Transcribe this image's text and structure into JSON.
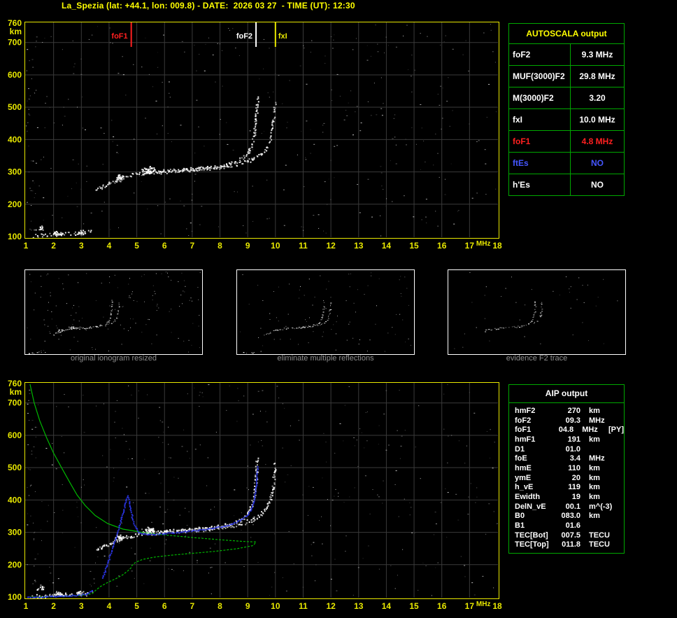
{
  "header": {
    "title": "La_Spezia (lat: +44.1, lon: 009.8) - DATE:  2026 03 27  - TIME (UT): 12:30"
  },
  "colors": {
    "background": "#000000",
    "axis_yellow": "#e8e800",
    "title_yellow": "#ffff00",
    "grid": "#3a3a3a",
    "trace_white": "#ffffff",
    "profile_green": "#00b800",
    "restored_blue": "#2a35e6",
    "fof1_red": "#ff2020",
    "ftes_blue": "#4556ff",
    "table_green": "#00a800",
    "caption_gray": "#8f8f8f"
  },
  "autoscala_table": {
    "title": "AUTOSCALA output",
    "rows": [
      {
        "label": "foF2",
        "value": "9.3 MHz",
        "color": "white"
      },
      {
        "label": "MUF(3000)F2",
        "value": "29.8 MHz",
        "color": "white"
      },
      {
        "label": "M(3000)F2",
        "value": "3.20",
        "color": "white"
      },
      {
        "label": "fxI",
        "value": "10.0 MHz",
        "color": "white"
      },
      {
        "label": "foF1",
        "value": "4.8 MHz",
        "color": "red"
      },
      {
        "label": "ftEs",
        "value": "NO",
        "color": "blue"
      },
      {
        "label": "h'Es",
        "value": "NO",
        "color": "white"
      }
    ]
  },
  "aip_table": {
    "title": "AIP output",
    "rows": [
      {
        "name": "hmF2",
        "value": "270",
        "unit": "km",
        "extra": ""
      },
      {
        "name": "foF2",
        "value": "09.3",
        "unit": "MHz",
        "extra": ""
      },
      {
        "name": "foF1",
        "value": "04.8",
        "unit": "MHz",
        "extra": "[PY]"
      },
      {
        "name": "hmF1",
        "value": "191",
        "unit": "km",
        "extra": ""
      },
      {
        "name": "D1",
        "value": "01.0",
        "unit": "",
        "extra": ""
      },
      {
        "name": "foE",
        "value": "3.4",
        "unit": "MHz",
        "extra": ""
      },
      {
        "name": "hmE",
        "value": "110",
        "unit": "km",
        "extra": ""
      },
      {
        "name": "ymE",
        "value": "20",
        "unit": "km",
        "extra": ""
      },
      {
        "name": "h_vE",
        "value": "119",
        "unit": "km",
        "extra": ""
      },
      {
        "name": "Ewidth",
        "value": "19",
        "unit": "km",
        "extra": ""
      },
      {
        "name": "DelN_vE",
        "value": "00.1",
        "unit": "m^(-3)",
        "extra": ""
      },
      {
        "name": "B0",
        "value": "083.0",
        "unit": "km",
        "extra": ""
      },
      {
        "name": "B1",
        "value": "01.6",
        "unit": "",
        "extra": ""
      },
      {
        "name": "TEC[Bot]",
        "value": "007.5",
        "unit": "TECU",
        "extra": ""
      },
      {
        "name": "TEC[Top]",
        "value": "011.8",
        "unit": "TECU",
        "extra": ""
      }
    ]
  },
  "thumbnails": [
    {
      "caption": "original ionogram resized",
      "mode": "full"
    },
    {
      "caption": "eliminate multiple reflections",
      "mode": "clean"
    },
    {
      "caption": "evidence F2 trace",
      "mode": "f2"
    }
  ],
  "chart_data": {
    "type": "scatter",
    "title": "Ionogram with AUTOSCALA automatic scaling and AIP electron density profile",
    "x_axis": {
      "label": "MHz",
      "range": [
        1,
        18
      ],
      "ticks": [
        1,
        2,
        3,
        4,
        5,
        6,
        7,
        8,
        9,
        10,
        11,
        12,
        13,
        14,
        15,
        16,
        17,
        18
      ]
    },
    "y_axis": {
      "label": "km",
      "range": [
        100,
        760
      ],
      "ticks": [
        760,
        700,
        600,
        500,
        400,
        300,
        200,
        100
      ]
    },
    "markers": [
      {
        "label": "foF1",
        "freq_mhz": 4.8,
        "color": "#ff2020",
        "side": "left"
      },
      {
        "label": "foF2",
        "freq_mhz": 9.3,
        "color": "#ffffff",
        "side": "left"
      },
      {
        "label": "fxI",
        "freq_mhz": 10.0,
        "color": "#e8e800",
        "side": "right"
      }
    ],
    "traces": {
      "e_layer": [
        [
          1.25,
          103
        ],
        [
          1.6,
          105
        ],
        [
          2.0,
          108
        ],
        [
          2.4,
          110
        ],
        [
          2.8,
          112
        ],
        [
          3.1,
          114
        ],
        [
          3.4,
          117
        ]
      ],
      "f_ordinary": [
        [
          3.55,
          246
        ],
        [
          3.8,
          258
        ],
        [
          4.1,
          270
        ],
        [
          4.4,
          281
        ],
        [
          4.7,
          289
        ],
        [
          5.0,
          295
        ],
        [
          5.4,
          300
        ],
        [
          5.8,
          303
        ],
        [
          6.2,
          305
        ],
        [
          6.6,
          308
        ],
        [
          7.0,
          310
        ],
        [
          7.4,
          313
        ],
        [
          7.8,
          317
        ],
        [
          8.1,
          322
        ],
        [
          8.4,
          328
        ],
        [
          8.65,
          336
        ],
        [
          8.85,
          346
        ],
        [
          9.0,
          360
        ],
        [
          9.1,
          378
        ],
        [
          9.18,
          400
        ],
        [
          9.24,
          428
        ],
        [
          9.28,
          460
        ],
        [
          9.31,
          495
        ],
        [
          9.33,
          535
        ]
      ],
      "f_extraordinary": [
        [
          5.7,
          300
        ],
        [
          6.3,
          303
        ],
        [
          6.9,
          307
        ],
        [
          7.5,
          311
        ],
        [
          8.0,
          316
        ],
        [
          8.5,
          323
        ],
        [
          8.9,
          332
        ],
        [
          9.2,
          342
        ],
        [
          9.45,
          355
        ],
        [
          9.62,
          370
        ],
        [
          9.75,
          390
        ],
        [
          9.84,
          415
        ],
        [
          9.9,
          445
        ],
        [
          9.94,
          480
        ],
        [
          9.97,
          520
        ]
      ]
    },
    "clusters": [
      {
        "f": 5.45,
        "km": 306,
        "n": 50,
        "sx": 9,
        "sy": 5
      },
      {
        "f": 4.35,
        "km": 283,
        "n": 28,
        "sx": 6,
        "sy": 4
      },
      {
        "f": 2.15,
        "km": 110,
        "n": 24,
        "sx": 10,
        "sy": 3
      },
      {
        "f": 3.0,
        "km": 113,
        "n": 18,
        "sx": 7,
        "sy": 3
      },
      {
        "f": 1.5,
        "km": 128,
        "n": 14,
        "sx": 6,
        "sy": 4
      }
    ],
    "noise": {
      "seed": 20260327,
      "count": 380
    },
    "profile": {
      "green_upper": [
        [
          1.15,
          758
        ],
        [
          1.3,
          700
        ],
        [
          1.5,
          645
        ],
        [
          1.75,
          592
        ],
        [
          2.0,
          545
        ],
        [
          2.3,
          498
        ],
        [
          2.6,
          452
        ],
        [
          2.85,
          415
        ],
        [
          3.15,
          382
        ],
        [
          3.5,
          352
        ],
        [
          3.95,
          327
        ],
        [
          4.5,
          310
        ],
        [
          5.2,
          300
        ]
      ],
      "green_lower": [
        [
          5.2,
          300
        ],
        [
          6.0,
          292
        ],
        [
          7.0,
          284
        ],
        [
          8.0,
          277
        ],
        [
          8.8,
          272
        ],
        [
          9.3,
          270
        ],
        [
          9.2,
          259
        ],
        [
          8.6,
          249
        ],
        [
          7.8,
          241
        ],
        [
          7.0,
          235
        ],
        [
          6.2,
          229
        ],
        [
          5.6,
          223
        ],
        [
          5.2,
          216
        ],
        [
          4.95,
          207
        ],
        [
          4.82,
          197
        ],
        [
          4.8,
          191
        ],
        [
          4.68,
          181
        ],
        [
          4.5,
          169
        ],
        [
          4.25,
          157
        ],
        [
          3.95,
          145
        ],
        [
          3.7,
          133
        ],
        [
          3.52,
          121
        ],
        [
          3.4,
          111
        ],
        [
          3.25,
          108
        ],
        [
          2.95,
          105
        ],
        [
          2.55,
          103
        ],
        [
          2.1,
          101
        ],
        [
          1.6,
          100
        ],
        [
          1.15,
          100
        ]
      ],
      "blue_e": [
        [
          1.05,
          100
        ],
        [
          1.5,
          101
        ],
        [
          1.95,
          103
        ],
        [
          2.4,
          105
        ],
        [
          2.8,
          107
        ],
        [
          3.1,
          110
        ],
        [
          3.3,
          117
        ],
        [
          3.4,
          126
        ]
      ],
      "blue_f": [
        [
          3.75,
          160
        ],
        [
          3.85,
          185
        ],
        [
          3.95,
          210
        ],
        [
          4.05,
          238
        ],
        [
          4.15,
          265
        ],
        [
          4.25,
          292
        ],
        [
          4.35,
          320
        ],
        [
          4.45,
          350
        ],
        [
          4.53,
          378
        ],
        [
          4.6,
          400
        ],
        [
          4.65,
          413
        ],
        [
          4.7,
          398
        ],
        [
          4.76,
          372
        ],
        [
          4.83,
          345
        ],
        [
          4.92,
          320
        ],
        [
          5.05,
          303
        ],
        [
          5.25,
          295
        ],
        [
          5.6,
          295
        ],
        [
          6.0,
          298
        ],
        [
          6.5,
          302
        ],
        [
          7.0,
          306
        ],
        [
          7.5,
          311
        ],
        [
          8.0,
          318
        ],
        [
          8.4,
          327
        ],
        [
          8.7,
          338
        ],
        [
          8.95,
          352
        ],
        [
          9.1,
          372
        ],
        [
          9.2,
          398
        ],
        [
          9.27,
          432
        ],
        [
          9.31,
          470
        ],
        [
          9.34,
          510
        ]
      ]
    }
  }
}
